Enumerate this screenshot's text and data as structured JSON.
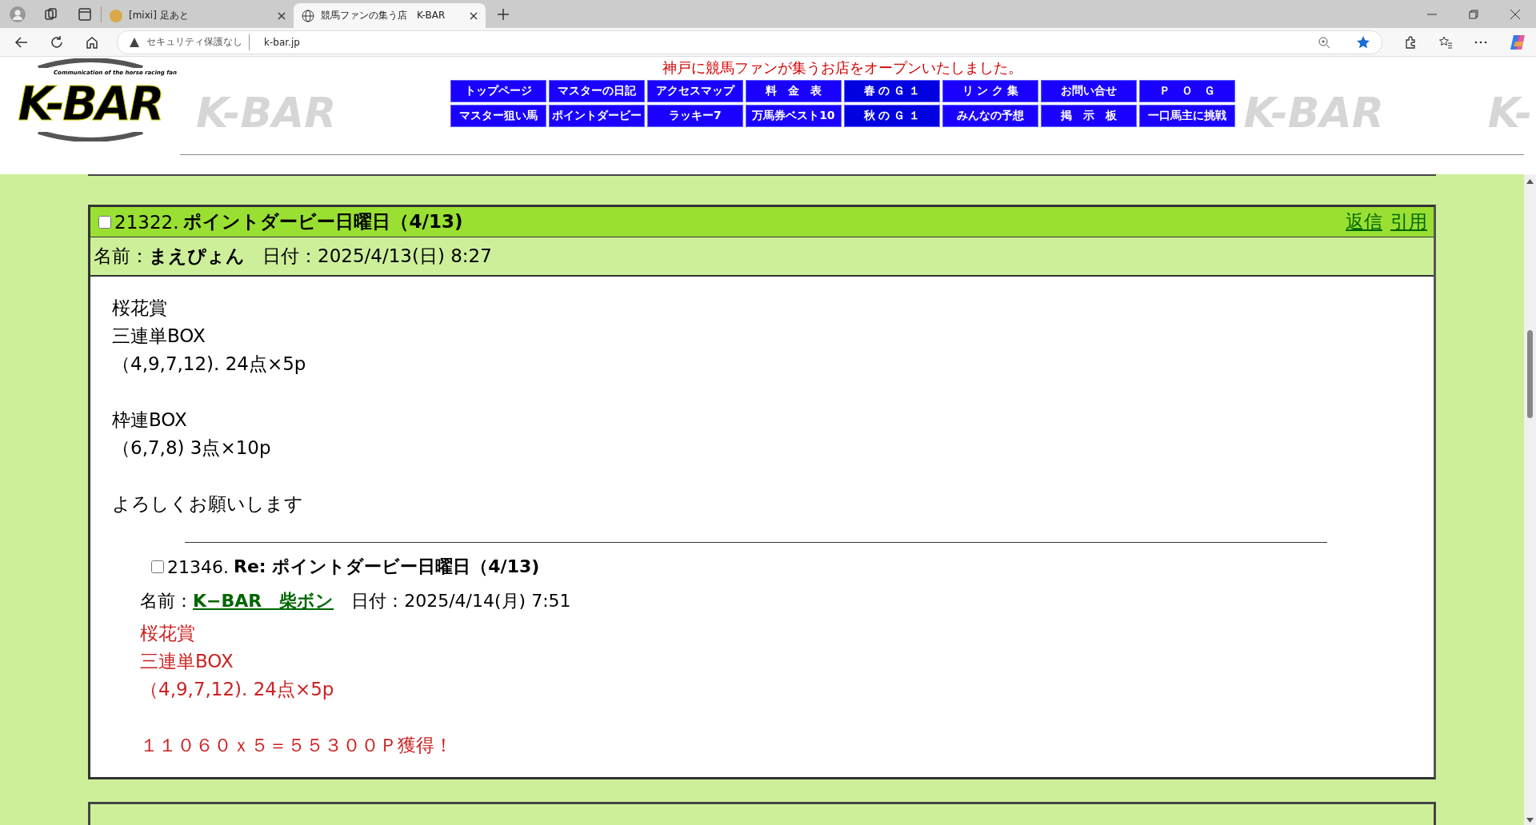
{
  "browser": {
    "tabs": [
      {
        "title": "[mixi] 足あと",
        "selected": false
      },
      {
        "title": "競馬ファンの集う店　K-BAR",
        "selected": true
      }
    ],
    "address": {
      "security": "セキュリティ保護なし",
      "url": "k-bar.jp"
    }
  },
  "header": {
    "logo": {
      "text": "K-BAR",
      "tagline": "Communication of the horse racing fan"
    },
    "faded_marks": [
      "K-BAR",
      "K-BAR",
      "K-"
    ],
    "announcement": "神戸に競馬ファンが集うお店をオープンいたしました。",
    "nav": [
      [
        {
          "label": "トップページ",
          "color": "#1a00ff"
        },
        {
          "label": "マスターの日記",
          "color": "#1a00ff"
        },
        {
          "label": "アクセスマップ",
          "color": "#1a00ff"
        },
        {
          "label": "料　金　表",
          "color": "#1a00ff"
        },
        {
          "label": "春 の Ｇ １",
          "color": "#0000e0"
        },
        {
          "label": "リ ン ク 集",
          "color": "#1a00ff"
        },
        {
          "label": "お問い合せ",
          "color": "#1a00ff"
        },
        {
          "label": "Ｐ　Ｏ　Ｇ",
          "color": "#1a00ff"
        }
      ],
      [
        {
          "label": "マスター狙い馬",
          "color": "#1a00ff"
        },
        {
          "label": "ポイントダービー",
          "color": "#1a00ff"
        },
        {
          "label": "ラッキー7",
          "color": "#1a00ff"
        },
        {
          "label": "万馬券ベスト10",
          "color": "#1a00ff"
        },
        {
          "label": "秋 の Ｇ １",
          "color": "#0000e0"
        },
        {
          "label": "みんなの予想",
          "color": "#1a00ff"
        },
        {
          "label": "掲　示　板",
          "color": "#1a00ff"
        },
        {
          "label": "一口馬主に挑戦",
          "color": "#1a00ff"
        }
      ]
    ]
  },
  "post": {
    "checked": false,
    "number": "21322.",
    "title": "ポイントダービー日曜日（4/13)",
    "links": [
      "返信",
      "引用"
    ],
    "name_label": "名前：",
    "name": "まえぴょん",
    "date": "日付：2025/4/13(日) 8:27",
    "body": [
      [
        "桜花賞",
        "三連単BOX",
        "（4,9,7,12). 24点×5p"
      ],
      [
        "枠連BOX",
        "（6,7,8) 3点×10p"
      ],
      [
        "よろしくお願いします"
      ]
    ],
    "reply": {
      "checked": false,
      "number": "21346.",
      "title": "Re: ポイントダービー日曜日（4/13)",
      "name_label": "名前：",
      "name": "K−BAR　柴ボン",
      "date": "日付：2025/4/14(月) 7:51",
      "body": [
        [
          "桜花賞",
          "三連単BOX",
          "（4,9,7,12). 24点×5p"
        ],
        [
          "１１０６０ｘ５＝５５３００Ｐ獲得！"
        ]
      ]
    }
  }
}
